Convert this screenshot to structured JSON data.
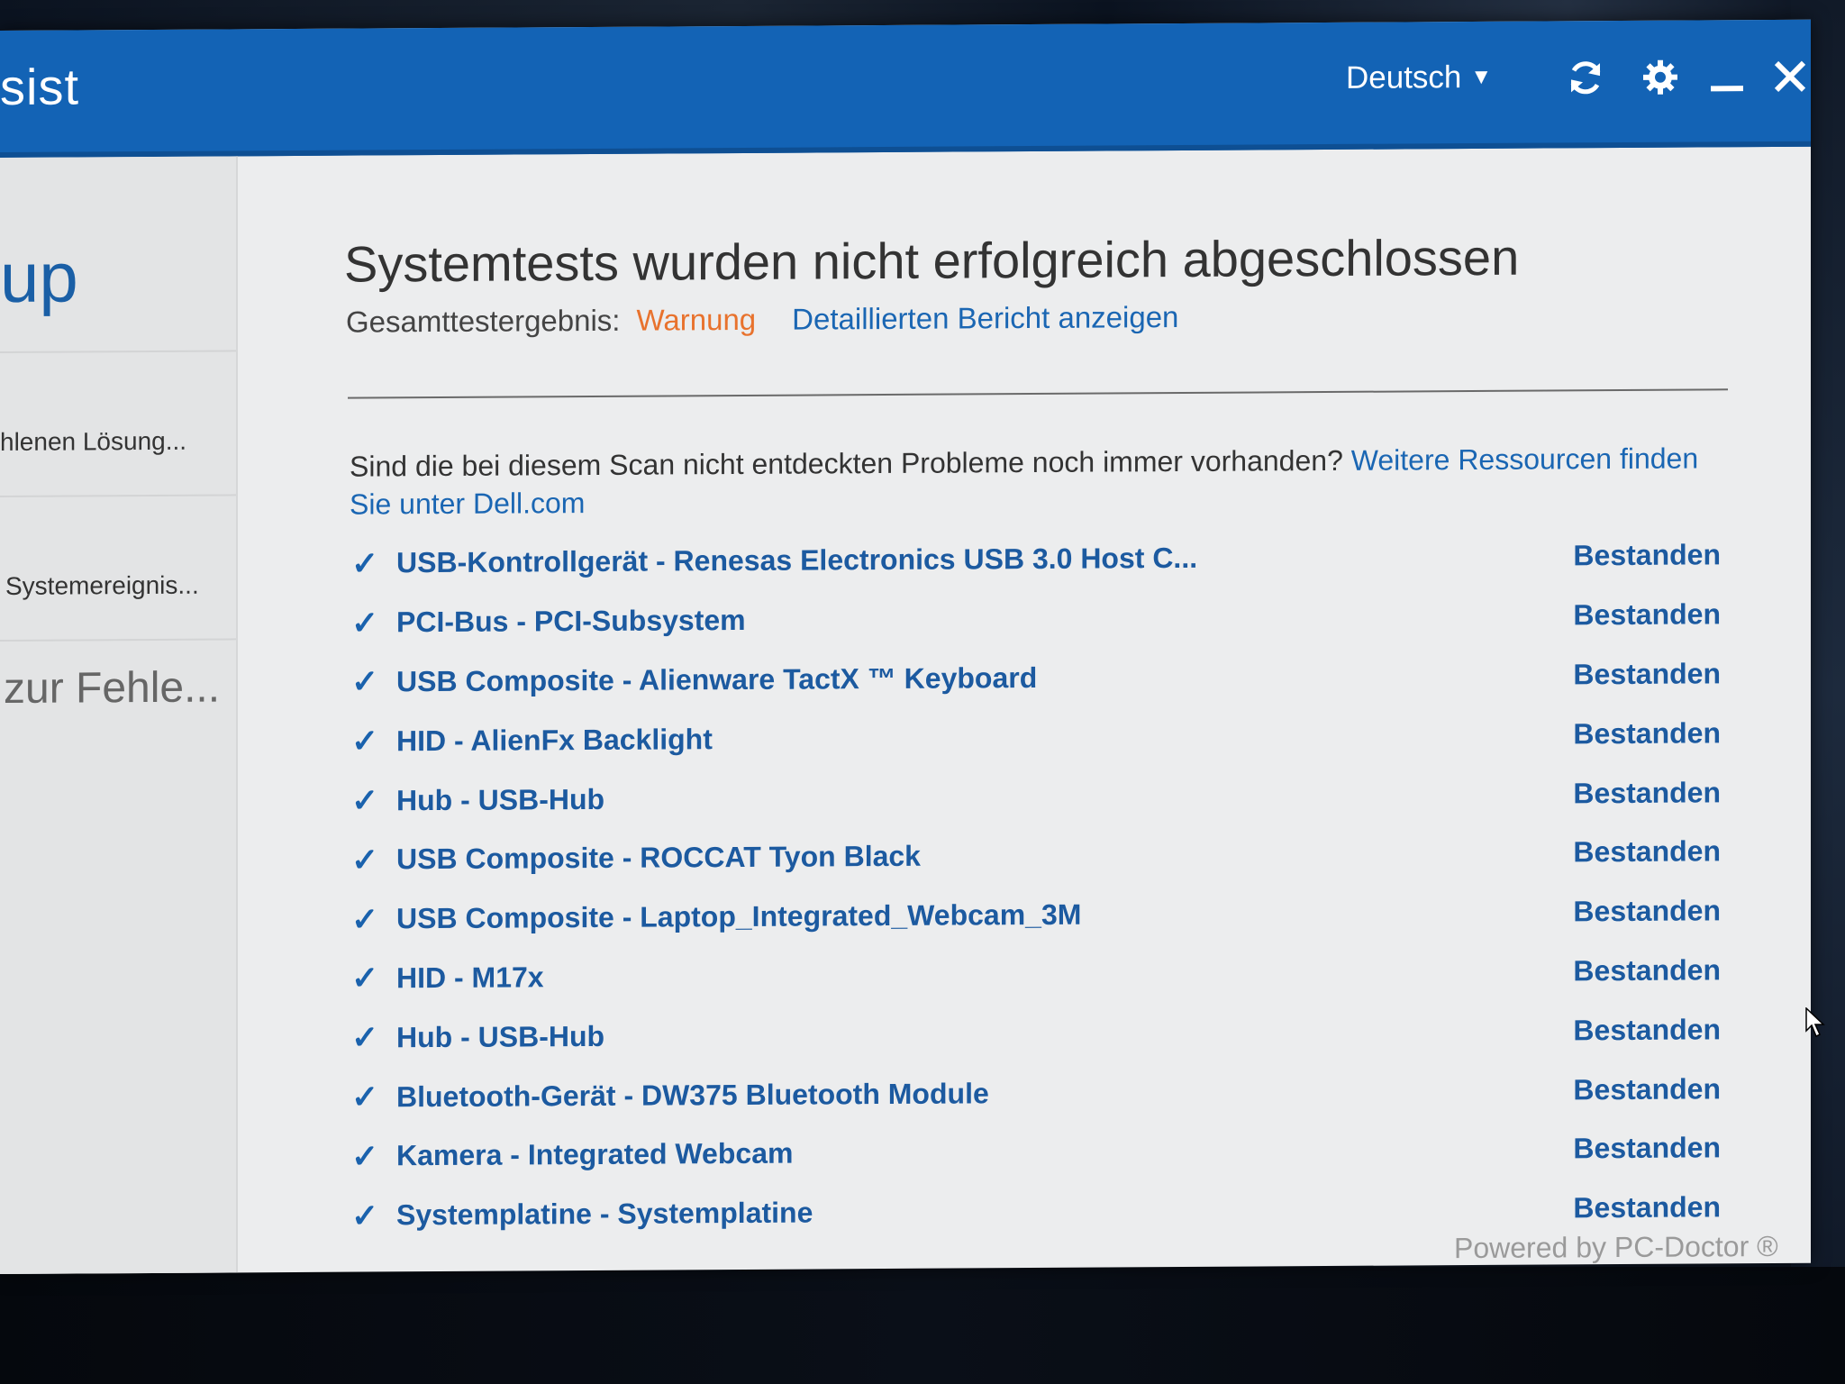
{
  "window": {
    "app_title": "sist",
    "language": "Deutsch"
  },
  "sidebar": {
    "heading": "up",
    "item_solution": "hlenen Lösung...",
    "item_events": "Systemereignis...",
    "item_errors": "zur Fehle..."
  },
  "main": {
    "heading": "Systemtests wurden nicht erfolgreich abgeschlossen",
    "overall_label": "Gesamttestergebnis:",
    "overall_value": "Warnung",
    "report_link": "Detaillierten Bericht anzeigen",
    "question_text": "Sind die bei diesem Scan nicht entdeckten Probleme noch immer vorhanden?",
    "question_link": "Weitere Ressourcen finden Sie unter Dell.com",
    "results": [
      {
        "name": "USB-Kontrollgerät - Renesas Electronics USB 3.0 Host C...",
        "status": "Bestanden"
      },
      {
        "name": "PCI-Bus - PCI-Subsystem",
        "status": "Bestanden"
      },
      {
        "name": "USB Composite - Alienware TactX ™ Keyboard",
        "status": "Bestanden"
      },
      {
        "name": "HID - AlienFx Backlight",
        "status": "Bestanden"
      },
      {
        "name": "Hub - USB-Hub",
        "status": "Bestanden"
      },
      {
        "name": "USB Composite - ROCCAT Tyon Black",
        "status": "Bestanden"
      },
      {
        "name": "USB Composite - Laptop_Integrated_Webcam_3M",
        "status": "Bestanden"
      },
      {
        "name": "HID - M17x",
        "status": "Bestanden"
      },
      {
        "name": "Hub - USB-Hub",
        "status": "Bestanden"
      },
      {
        "name": "Bluetooth-Gerät - DW375 Bluetooth Module",
        "status": "Bestanden"
      },
      {
        "name": "Kamera - Integrated Webcam",
        "status": "Bestanden"
      },
      {
        "name": "Systemplatine - Systemplatine",
        "status": "Bestanden"
      }
    ],
    "check_glyph": "✓",
    "powered_by": "Powered by PC-Doctor ®"
  },
  "colors": {
    "titlebar": "#1363b5",
    "link": "#1a66b3",
    "warning": "#e8722d",
    "result_text": "#1c5aa0"
  }
}
